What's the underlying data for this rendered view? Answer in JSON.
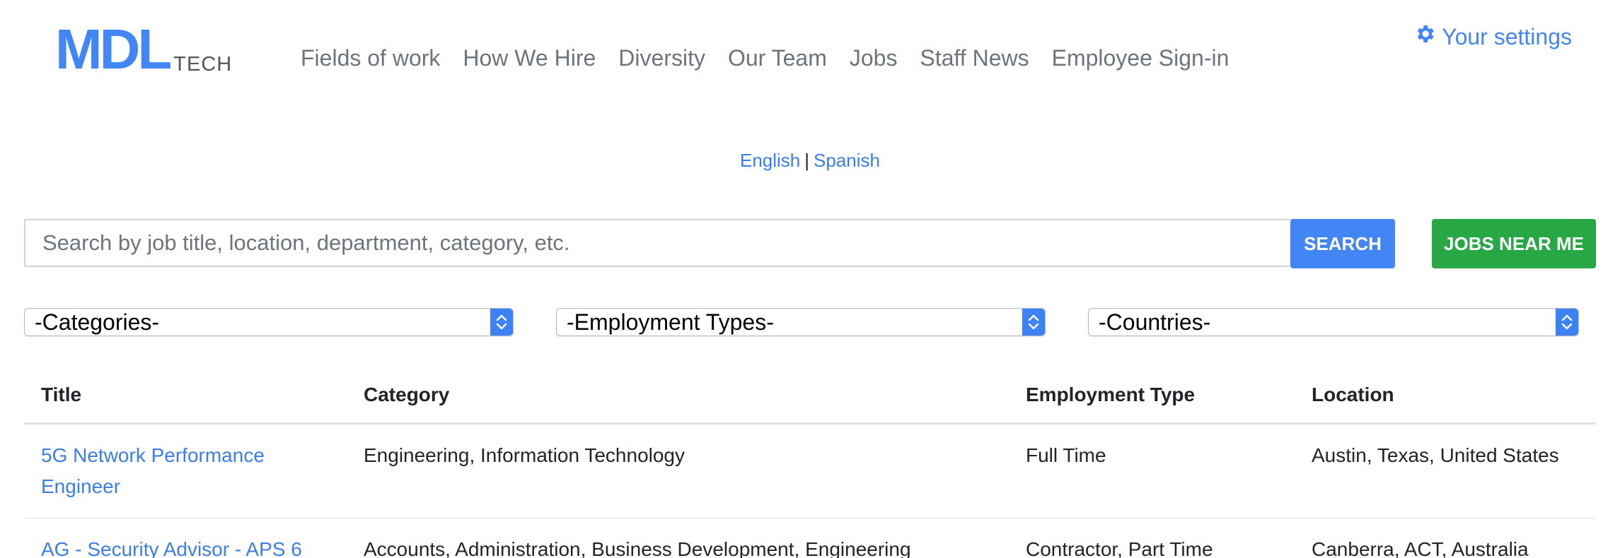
{
  "brand": {
    "logo_mark": "MDL",
    "logo_sub": "TECH"
  },
  "nav": {
    "items": [
      {
        "label": "Fields of work"
      },
      {
        "label": "How We Hire"
      },
      {
        "label": "Diversity"
      },
      {
        "label": "Our Team"
      },
      {
        "label": "Jobs"
      },
      {
        "label": "Staff News"
      },
      {
        "label": "Employee Sign-in"
      }
    ]
  },
  "settings": {
    "label": "Your settings",
    "icon": "gear-icon"
  },
  "language": {
    "english": "English",
    "separator": "|",
    "spanish": "Spanish"
  },
  "search": {
    "placeholder": "Search by job title, location, department, category, etc.",
    "value": "",
    "search_label": "SEARCH",
    "near_label": "JOBS NEAR ME"
  },
  "filters": {
    "categories": "-Categories-",
    "employment_types": "-Employment Types-",
    "countries": "-Countries-"
  },
  "table": {
    "headers": [
      "Title",
      "Category",
      "Employment Type",
      "Location"
    ],
    "rows": [
      {
        "title": "5G Network Performance Engineer",
        "category": "Engineering, Information Technology",
        "type": "Full Time",
        "location": "Austin, Texas, United States"
      },
      {
        "title": "AG - Security Advisor - APS 6",
        "category": "Accounts, Administration, Business Development, Engineering",
        "type": "Contractor, Part Time",
        "location": "Canberra, ACT, Australia"
      }
    ]
  },
  "colors": {
    "accent": "#4285f4",
    "link": "#3b7de9",
    "success": "#28a745",
    "nav_text": "#6c757d"
  }
}
